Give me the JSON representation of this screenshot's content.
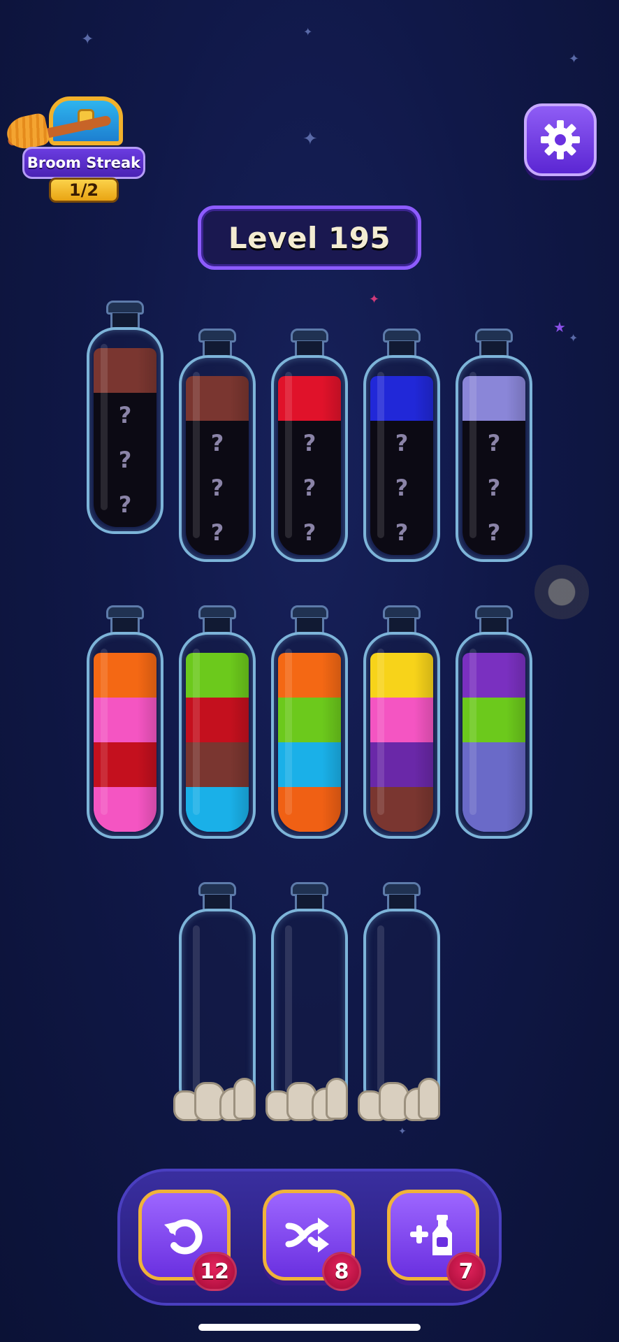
{
  "broom_streak": {
    "label": "Broom Streak",
    "progress": "1/2",
    "icons": [
      "treasure-chest-icon",
      "broom-icon"
    ]
  },
  "settings": {
    "icon": "gear-icon"
  },
  "level": {
    "label": "Level 195"
  },
  "hidden_mark": "?",
  "tubes": [
    {
      "row": 1,
      "layers_bottom_to_top": [
        "hidden",
        "hidden",
        "hidden",
        "#7a3630"
      ]
    },
    {
      "row": 1,
      "layers_bottom_to_top": [
        "hidden",
        "hidden",
        "hidden",
        "#7a3630"
      ]
    },
    {
      "row": 1,
      "layers_bottom_to_top": [
        "hidden",
        "hidden",
        "hidden",
        "#e0122a"
      ]
    },
    {
      "row": 1,
      "layers_bottom_to_top": [
        "hidden",
        "hidden",
        "hidden",
        "#2128d8"
      ]
    },
    {
      "row": 1,
      "layers_bottom_to_top": [
        "hidden",
        "hidden",
        "hidden",
        "#8a86d8"
      ]
    },
    {
      "row": 2,
      "layers_bottom_to_top": [
        "#f455c2",
        "#c4101e",
        "#f455c2",
        "#f46814"
      ]
    },
    {
      "row": 2,
      "layers_bottom_to_top": [
        "#1ab0e8",
        "#7a3630",
        "#c4101e",
        "#6cc91c"
      ]
    },
    {
      "row": 2,
      "layers_bottom_to_top": [
        "#f06014",
        "#1ab0e8",
        "#6cc91c",
        "#f46814"
      ]
    },
    {
      "row": 2,
      "layers_bottom_to_top": [
        "#7a3630",
        "#6a28a8",
        "#f455c2",
        "#f7d31a"
      ]
    },
    {
      "row": 2,
      "layers_bottom_to_top": [
        "#6a6ac8",
        "#6a6ac8",
        "#6cc91c",
        "#7a30c0"
      ]
    },
    {
      "row": 3,
      "layers_bottom_to_top": [],
      "blocked_by": "rocks"
    },
    {
      "row": 3,
      "layers_bottom_to_top": [],
      "blocked_by": "rocks"
    },
    {
      "row": 3,
      "layers_bottom_to_top": [],
      "blocked_by": "rocks"
    }
  ],
  "toolbar": {
    "undo": {
      "icon": "undo-icon",
      "count": "12"
    },
    "shuffle": {
      "icon": "shuffle-icon",
      "count": "8"
    },
    "add_tube": {
      "icon": "add-bottle-icon",
      "count": "7"
    }
  }
}
